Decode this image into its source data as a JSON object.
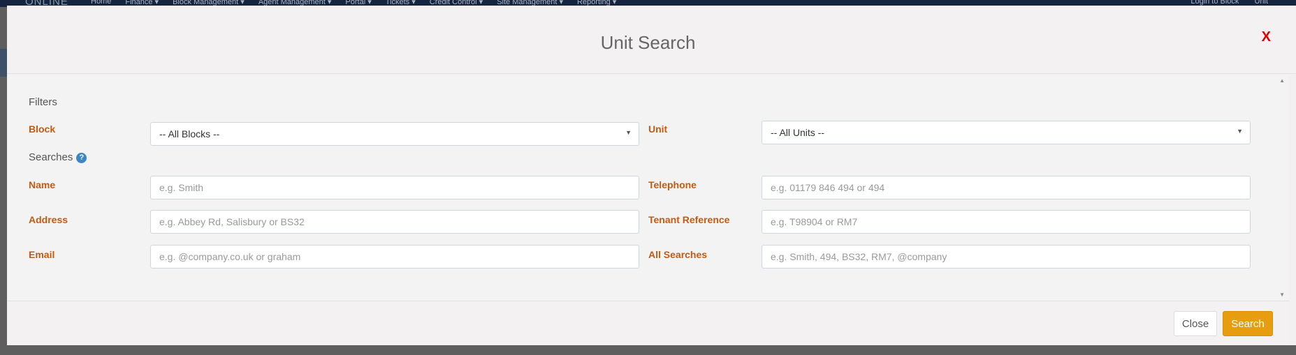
{
  "background": {
    "logo": "ONLINE",
    "nav": [
      "Home",
      "Finance ▾",
      "Block Management ▾",
      "Agent Management ▾",
      "Portal ▾",
      "Tickets ▾",
      "Credit Control ▾",
      "Site Management ▾",
      "Reporting ▾"
    ],
    "nav_right": [
      "Login to Block",
      "Unit"
    ]
  },
  "modal": {
    "title": "Unit Search",
    "close_x": "X",
    "filters_heading": "Filters",
    "searches_heading": "Searches",
    "help_icon_glyph": "?",
    "block": {
      "label": "Block",
      "selected": "-- All Blocks --"
    },
    "unit": {
      "label": "Unit",
      "selected": "-- All Units --"
    },
    "name": {
      "label": "Name",
      "placeholder": "e.g. Smith"
    },
    "telephone": {
      "label": "Telephone",
      "placeholder": "e.g. 01179 846 494 or 494"
    },
    "address": {
      "label": "Address",
      "placeholder": "e.g. Abbey Rd, Salisbury or BS32"
    },
    "tenant_reference": {
      "label": "Tenant Reference",
      "placeholder": "e.g. T98904 or RM7"
    },
    "email": {
      "label": "Email",
      "placeholder": "e.g. @company.co.uk or graham"
    },
    "all_searches": {
      "label": "All Searches",
      "placeholder": "e.g. Smith, 494, BS32, RM7, @company"
    },
    "close_button": "Close",
    "search_button": "Search"
  },
  "colors": {
    "label_accent": "#c55a11",
    "search_button": "#e69d0f",
    "close_x": "#e00000",
    "help_icon": "#3b86c8"
  }
}
